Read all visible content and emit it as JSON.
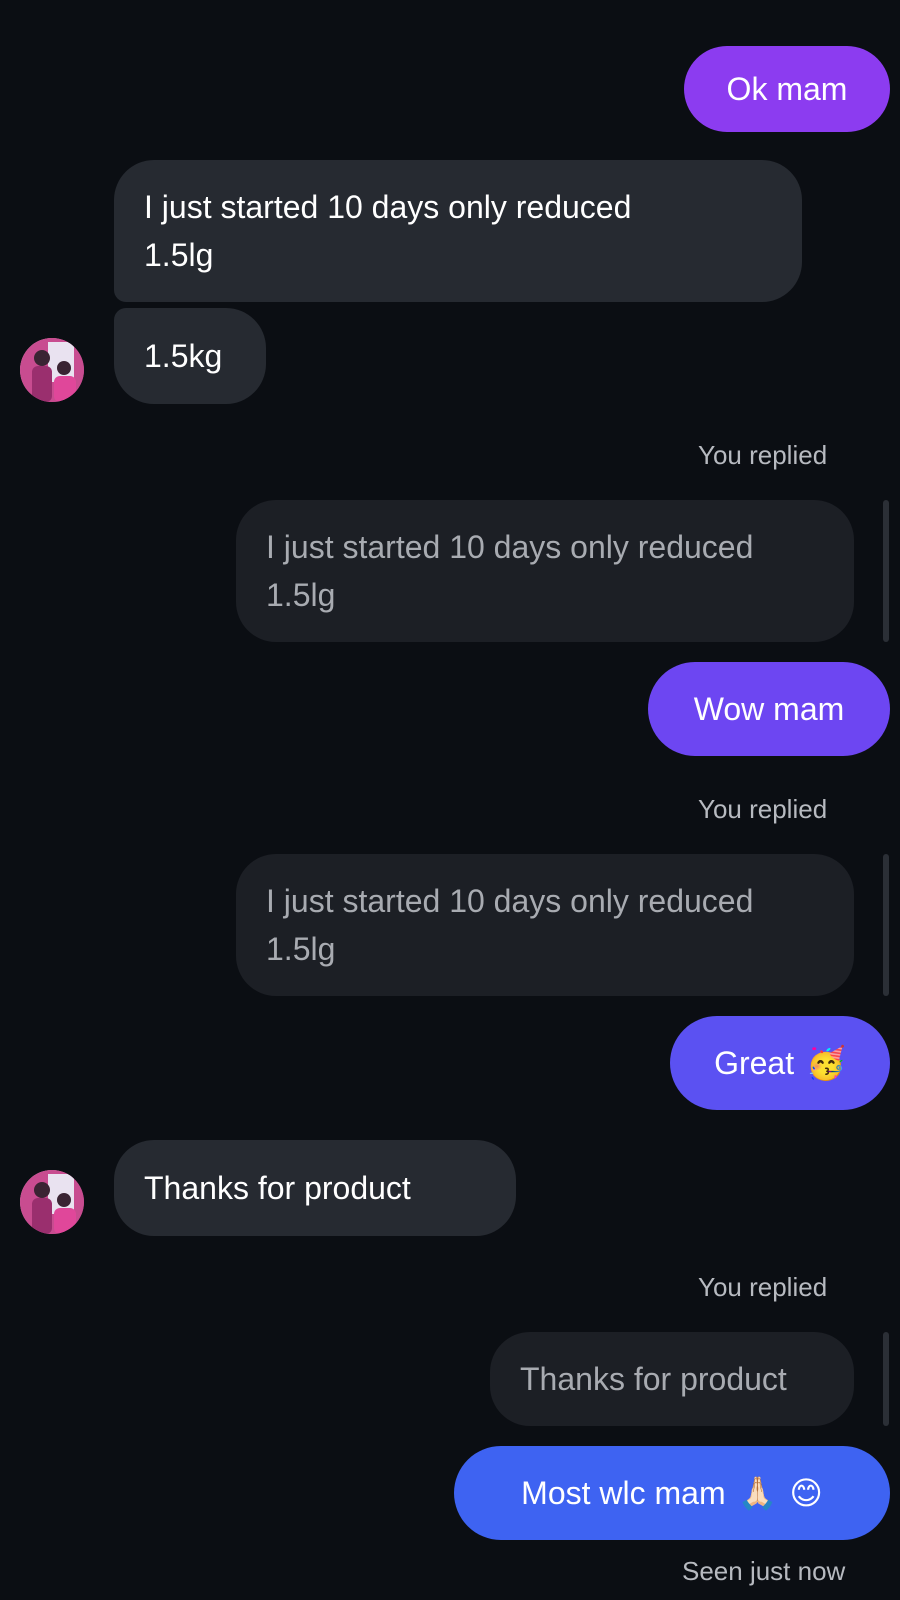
{
  "messages": {
    "ok_mam": "Ok mam",
    "incoming_1": "I just started 10 days only reduced\n1.5lg",
    "incoming_2": "1.5kg",
    "you_replied_1": "You replied",
    "quoted_1": "I just started 10 days only reduced\n1.5lg",
    "wow_mam": "Wow mam",
    "you_replied_2": "You replied",
    "quoted_2": "I just started 10 days only reduced\n1.5lg",
    "great": "Great",
    "great_emoji": "🥳",
    "thanks": "Thanks for product",
    "you_replied_3": "You replied",
    "quoted_3": "Thanks for product",
    "most_wlc": "Most wlc mam",
    "most_wlc_emoji_1": "🙏🏻",
    "most_wlc_emoji_2": "😊",
    "seen": "Seen just now"
  },
  "colors": {
    "background": "#0b0e13",
    "incoming_bubble": "#262a31",
    "quoted_bubble": "#1c1f25",
    "outgoing_purple": "#8c3cf0",
    "outgoing_violet": "#6a4df2",
    "outgoing_blue": "#3e63f2"
  },
  "icons": {
    "avatar": "contact-avatar-photo"
  }
}
